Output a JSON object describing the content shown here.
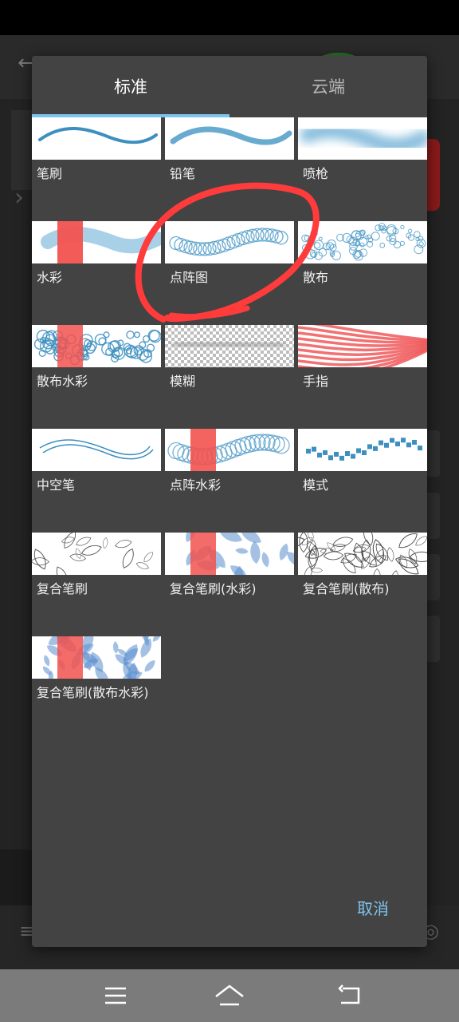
{
  "dialog": {
    "tabs": [
      {
        "label": "标准",
        "active": true
      },
      {
        "label": "云端",
        "active": false
      }
    ],
    "brushes": [
      {
        "label": "笔刷",
        "thumb": "brush-stroke"
      },
      {
        "label": "铅笔",
        "thumb": "pencil-stroke"
      },
      {
        "label": "喷枪",
        "thumb": "airbrush-stroke"
      },
      {
        "label": "水彩",
        "thumb": "watercolor-stroke"
      },
      {
        "label": "点阵图",
        "thumb": "bitmap-stroke"
      },
      {
        "label": "散布",
        "thumb": "scatter-stroke"
      },
      {
        "label": "散布水彩",
        "thumb": "scatter-watercolor-stroke"
      },
      {
        "label": "模糊",
        "thumb": "blur-stroke"
      },
      {
        "label": "手指",
        "thumb": "finger-stroke"
      },
      {
        "label": "中空笔",
        "thumb": "hollow-pen-stroke"
      },
      {
        "label": "点阵水彩",
        "thumb": "bitmap-watercolor-stroke"
      },
      {
        "label": "模式",
        "thumb": "pattern-stroke"
      },
      {
        "label": "复合笔刷",
        "thumb": "composite-brush-stroke"
      },
      {
        "label": "复合笔刷(水彩)",
        "thumb": "composite-watercolor-stroke"
      },
      {
        "label": "复合笔刷(散布)",
        "thumb": "composite-scatter-stroke"
      },
      {
        "label": "复合笔刷(散布水彩)",
        "thumb": "composite-scatter-watercolor-stroke"
      }
    ],
    "cancel_label": "取消"
  },
  "navigation": {
    "menu_icon": "menu-icon",
    "home_icon": "home-icon",
    "back_icon": "back-icon"
  },
  "colors": {
    "accent": "#7fc4ee",
    "dialog_bg": "#434343",
    "stroke_blue": "#3d8fc0",
    "annotation_red": "#ff3b3b",
    "watercolor_red": "#f2524f"
  }
}
